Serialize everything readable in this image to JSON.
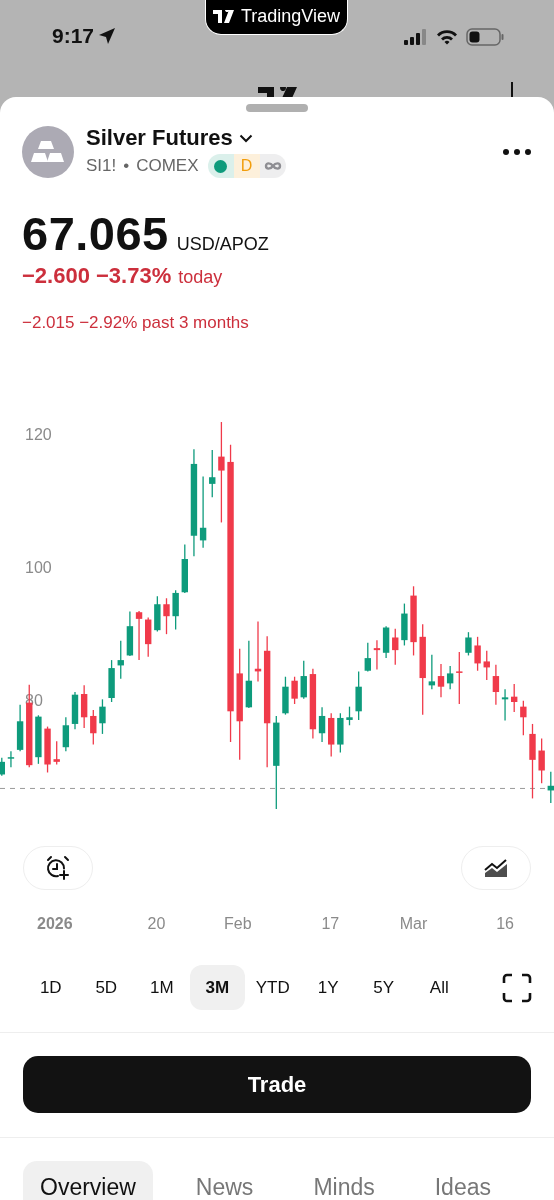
{
  "status_bar": {
    "time": "9:17",
    "island_label": "TradingView"
  },
  "symbol": {
    "name": "Silver Futures",
    "ticker": "SI1!",
    "separator": "•",
    "exchange": "COMEX",
    "badges": [
      {
        "kind": "dot",
        "color": "#0e9b7c"
      },
      {
        "kind": "letter",
        "text": "D",
        "color": "#f29d0b"
      },
      {
        "kind": "infinity",
        "color": "#8e8e93"
      }
    ]
  },
  "price": {
    "value": "67.065",
    "currency": "USD/APOZ",
    "change_today": "−2.600 −3.73%",
    "today_label": "today",
    "change_period": "−2.015 −2.92% past 3 months"
  },
  "chart": {
    "y_labels": [
      "120",
      "100",
      "80"
    ],
    "date_labels": [
      "2026",
      "20",
      "Feb",
      "17",
      "Mar",
      "16"
    ]
  },
  "chart_buttons": [
    {
      "kind": "alarm"
    },
    {
      "kind": "indicators"
    }
  ],
  "ranges": [
    {
      "label": "1D",
      "selected": false
    },
    {
      "label": "5D",
      "selected": false
    },
    {
      "label": "1M",
      "selected": false
    },
    {
      "label": "3M",
      "selected": true
    },
    {
      "label": "YTD",
      "selected": false
    },
    {
      "label": "1Y",
      "selected": false
    },
    {
      "label": "5Y",
      "selected": false
    },
    {
      "label": "All",
      "selected": false
    }
  ],
  "trade_button": {
    "label": "Trade"
  },
  "tabs": [
    {
      "label": "Overview",
      "selected": true
    },
    {
      "label": "News",
      "selected": false
    },
    {
      "label": "Minds",
      "selected": false
    },
    {
      "label": "Ideas",
      "selected": false
    }
  ]
}
